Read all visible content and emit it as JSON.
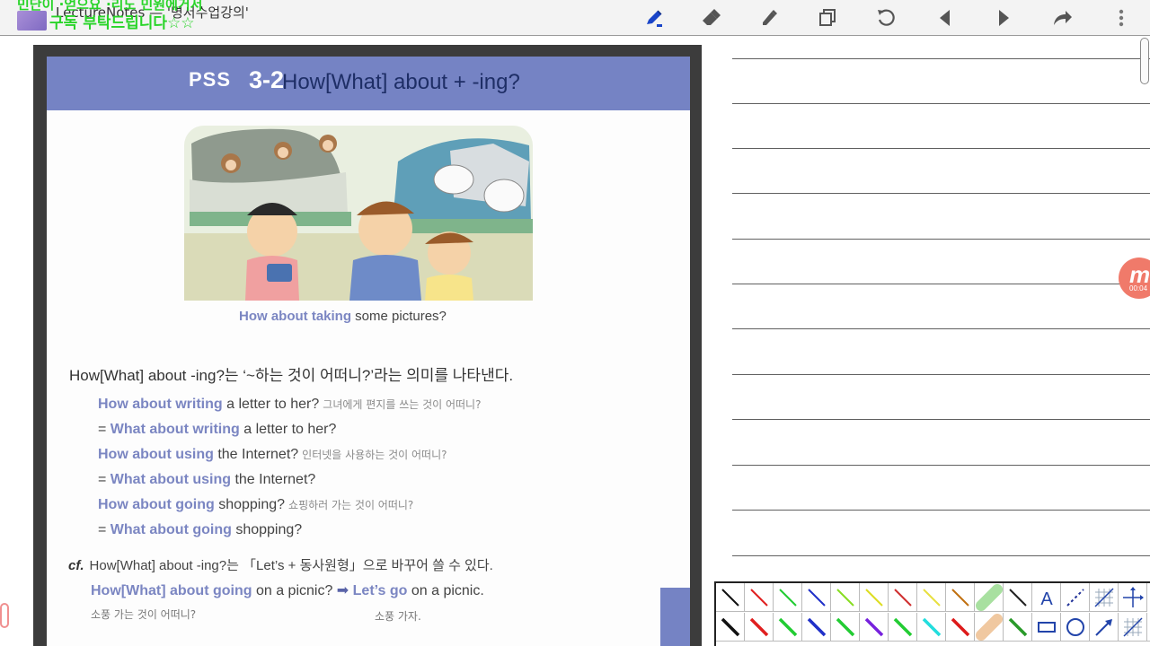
{
  "app": {
    "title": "LectureNotes — '명서수업강의'",
    "overlay_line1": "민단이 ·얻으요 ·리도 민원에거서",
    "overlay_line2": "구독 부탁드립니다☆☆"
  },
  "toolbar": {
    "icons": [
      "pen-icon",
      "eraser-icon",
      "highlighter-icon",
      "copy-page-icon",
      "undo-icon",
      "prev-page-icon",
      "next-page-icon",
      "redo-icon",
      "more-icon"
    ],
    "active_color": "#1a45c8"
  },
  "book": {
    "banner_pss": "PSS",
    "banner_num": "3-2",
    "banner_title": "How[What] about + -ing?",
    "caption_highlight": "How about taking",
    "caption_rest": " some pictures?",
    "intro": "How[What] about -ing?는 ‘~하는 것이 어떠니?’라는 의미를 나타낸다.",
    "examples": [
      {
        "hl": "How about writing",
        "rest": " a letter to her?",
        "ko": "그녀에게 편지를 쓰는 것이 어떠니?"
      },
      {
        "pre": "= ",
        "hl": "What about writing",
        "rest": " a letter to her?",
        "ko": ""
      },
      {
        "hl": "How about using",
        "rest": " the Internet?",
        "ko": "인터넷을 사용하는 것이 어떠니?"
      },
      {
        "pre": "= ",
        "hl": "What about using",
        "rest": " the Internet?",
        "ko": ""
      },
      {
        "hl": "How about going",
        "rest": " shopping?",
        "ko": "쇼핑하러 가는 것이 어떠니?"
      },
      {
        "pre": "= ",
        "hl": "What about going",
        "rest": " shopping?",
        "ko": ""
      }
    ],
    "cf_label": "cf.",
    "cf_text": "How[What] about -ing?는 「Let’s + 동사원형」으로 바꾸어 쓸 수 있다.",
    "cf_example_hl1": "How[What] about going",
    "cf_example_mid": " on a picnic? ",
    "cf_arrow": "➡",
    "cf_example_hl2": "Let’s go",
    "cf_example_end": " on a picnic.",
    "cf_ko1": "소풍 가는 것이 어떠니?",
    "cf_ko2": "소풍 가자."
  },
  "recorder": {
    "badge_letter": "m",
    "time": "00:04"
  },
  "palette": {
    "row1": [
      {
        "type": "line",
        "color": "#111111"
      },
      {
        "type": "line",
        "color": "#e02020"
      },
      {
        "type": "line",
        "color": "#22cc33"
      },
      {
        "type": "line",
        "color": "#2030c8"
      },
      {
        "type": "line",
        "color": "#88dd22"
      },
      {
        "type": "line",
        "color": "#dddd22"
      },
      {
        "type": "line",
        "color": "#d03030"
      },
      {
        "type": "line",
        "color": "#e8e040"
      },
      {
        "type": "line",
        "color": "#c07010"
      },
      {
        "type": "marker",
        "color": "#a8e0a0"
      },
      {
        "type": "line",
        "color": "#222222"
      },
      {
        "type": "text",
        "label": "A"
      },
      {
        "type": "dashed",
        "color": "#223399"
      },
      {
        "type": "grid",
        "color": "#2244aa"
      },
      {
        "type": "axes",
        "color": "#2244aa"
      }
    ],
    "row2": [
      {
        "type": "thick",
        "color": "#111111"
      },
      {
        "type": "thick",
        "color": "#e02020"
      },
      {
        "type": "thick",
        "color": "#22cc33"
      },
      {
        "type": "thick",
        "color": "#2030c8"
      },
      {
        "type": "thick",
        "color": "#22cc33"
      },
      {
        "type": "thick",
        "color": "#7722dd"
      },
      {
        "type": "thick",
        "color": "#22cc33"
      },
      {
        "type": "thick",
        "color": "#22dddd"
      },
      {
        "type": "thick",
        "color": "#dd1a1a"
      },
      {
        "type": "marker",
        "color": "#f0c8a0"
      },
      {
        "type": "thick",
        "color": "#2a9a2a"
      },
      {
        "type": "rect",
        "color": "#2244aa"
      },
      {
        "type": "circle",
        "color": "#2244aa"
      },
      {
        "type": "arrow",
        "color": "#2244aa"
      },
      {
        "type": "grid",
        "color": "#2244aa"
      },
      {
        "type": "axes",
        "color": "#2244aa"
      }
    ]
  }
}
